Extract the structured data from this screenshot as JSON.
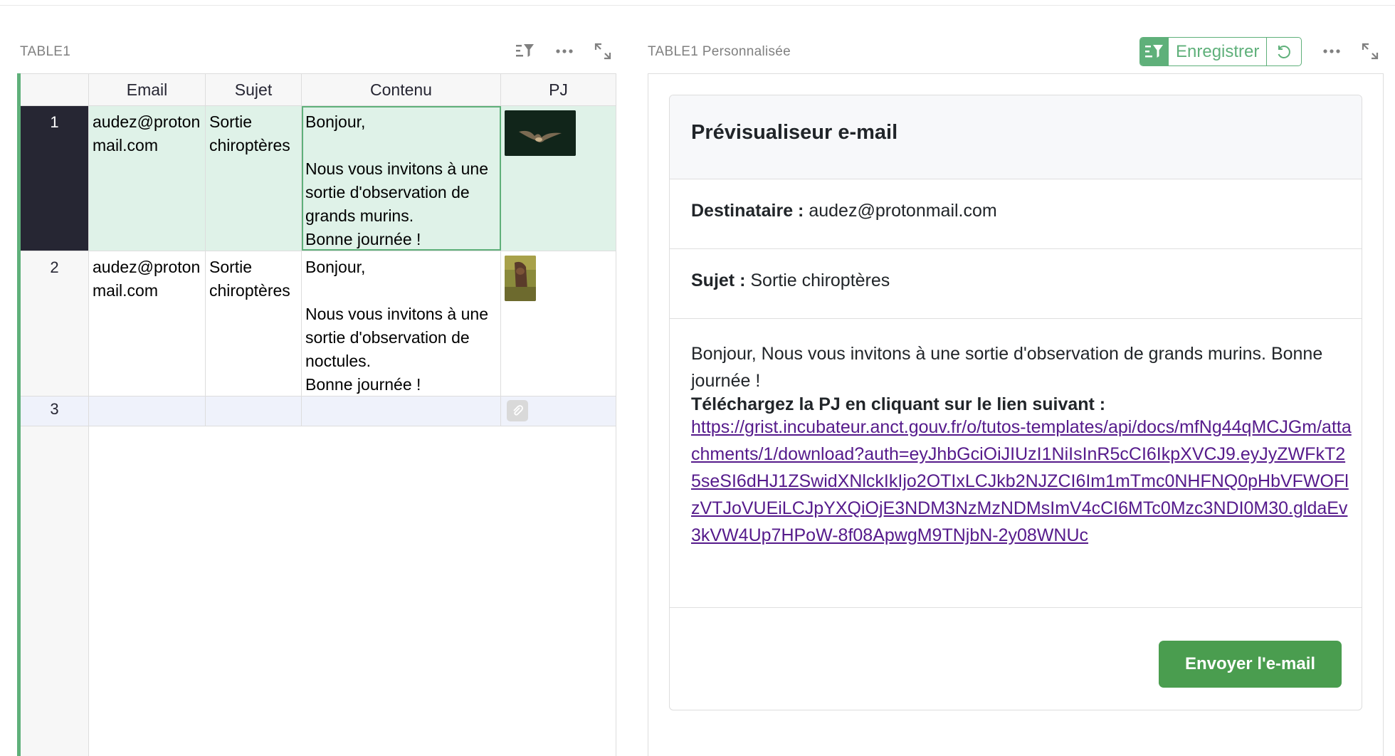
{
  "left_panel": {
    "title": "TABLE1",
    "columns": [
      "Email",
      "Sujet",
      "Contenu",
      "PJ"
    ],
    "rows": [
      {
        "num": "1",
        "email": "audez@protonmail.com",
        "sujet": "Sortie chiroptères",
        "contenu": "Bonjour,\n\nNous vous invitons à une sortie d'observation de grands murins.\nBonne journée !",
        "pj": "bat-photo-thumbnail"
      },
      {
        "num": "2",
        "email": "audez@protonmail.com",
        "sujet": "Sortie chiroptères",
        "contenu": "Bonjour,\n\nNous vous invitons à une sortie d'observation de noctules.\nBonne journée !",
        "pj": "bat-photo-thumbnail"
      },
      {
        "num": "3"
      }
    ]
  },
  "right_panel": {
    "title": "TABLE1 Personnalisée",
    "save_label": "Enregistrer",
    "preview": {
      "title": "Prévisualiseur e-mail",
      "recipient_label": "Destinataire :",
      "recipient_value": "audez@protonmail.com",
      "subject_label": "Sujet :",
      "subject_value": "Sortie chiroptères",
      "body": "Bonjour, Nous vous invitons à une sortie d'observation de grands murins. Bonne journée !",
      "download_label": "Téléchargez la PJ en cliquant sur le lien suivant :",
      "download_link": "https://grist.incubateur.anct.gouv.fr/o/tutos-templates/api/docs/mfNg44qMCJGm/attachments/1/download?auth=eyJhbGciOiJIUzI1NiIsInR5cCI6IkpXVCJ9.eyJyZWFkT25seSI6dHJ1ZSwidXNlckIkIjo2OTIxLCJkb2NJZCI6Im1mTmc0NHFNQ0pHbVFWOFlzVTJoVUEiLCJpYXQiOjE3NDM3NzMzNDMsImV4cCI6MTc0Mzc3NDI0M30.gldaEv3kVW4Up7HPoW-8f08ApwgM9TNjbN-2y08WNUc",
      "send_label": "Envoyer l'e-mail"
    }
  },
  "colors": {
    "accent": "#5fb07a",
    "selected_row": "#dff2e8",
    "row_number_selected": "#262633",
    "link": "#551a8b",
    "send_button": "#4a9d4f"
  }
}
